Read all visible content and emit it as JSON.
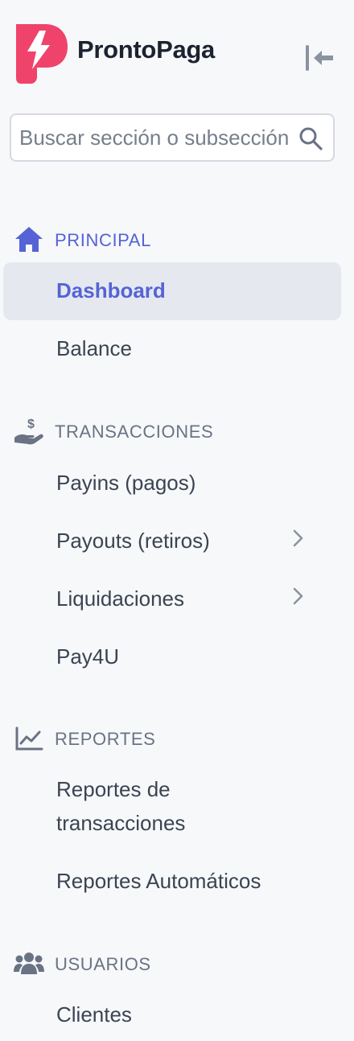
{
  "brand": {
    "name": "ProntoPaga"
  },
  "search": {
    "placeholder": "Buscar sección o subsección"
  },
  "colors": {
    "accent": "#5563d6",
    "logo": "#f0436b",
    "active_bg": "#e5e9ef"
  },
  "nav": {
    "principal": {
      "title": "PRINCIPAL",
      "icon": "home-icon",
      "items": [
        {
          "label": "Dashboard",
          "active": true
        },
        {
          "label": "Balance"
        }
      ]
    },
    "transacciones": {
      "title": "TRANSACCIONES",
      "icon": "money-hand-icon",
      "items": [
        {
          "label": "Payins (pagos)"
        },
        {
          "label": "Payouts (retiros)",
          "has_submenu": true
        },
        {
          "label": "Liquidaciones",
          "has_submenu": true
        },
        {
          "label": "Pay4U"
        }
      ]
    },
    "reportes": {
      "title": "REPORTES",
      "icon": "chart-line-icon",
      "items": [
        {
          "label_line1": "Reportes de",
          "label_line2": "transacciones"
        },
        {
          "label": "Reportes Automáticos"
        }
      ]
    },
    "usuarios": {
      "title": "USUARIOS",
      "icon": "users-icon",
      "items": [
        {
          "label": "Clientes"
        }
      ]
    }
  }
}
